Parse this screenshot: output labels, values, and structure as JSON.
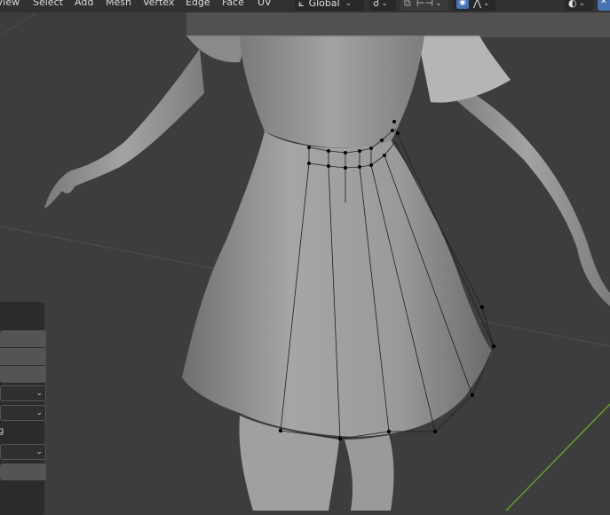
{
  "header": {
    "menus": [
      "View",
      "Select",
      "Add",
      "Mesh",
      "Vertex",
      "Edge",
      "Face",
      "UV"
    ],
    "transform_orientation": "Global"
  },
  "icons": {
    "orientation": "transform-orientation-icon",
    "pivot": "pivot-point-icon",
    "snap": "snap-icon",
    "snap_increment": "snap-increment-icon",
    "proportional": "proportional-editing-icon",
    "falloff": "falloff-icon",
    "viewport_shading": "viewport-shading-icon"
  },
  "operator_panel": {
    "label_partial": "g"
  },
  "colors": {
    "viewport_bg": "#3d3d3d",
    "header_bg": "#303030",
    "accent_blue": "#4772b3",
    "axis_y_green": "#6a9a2a",
    "grid": "#4a4a4a",
    "mesh_vertex": "#000000"
  }
}
